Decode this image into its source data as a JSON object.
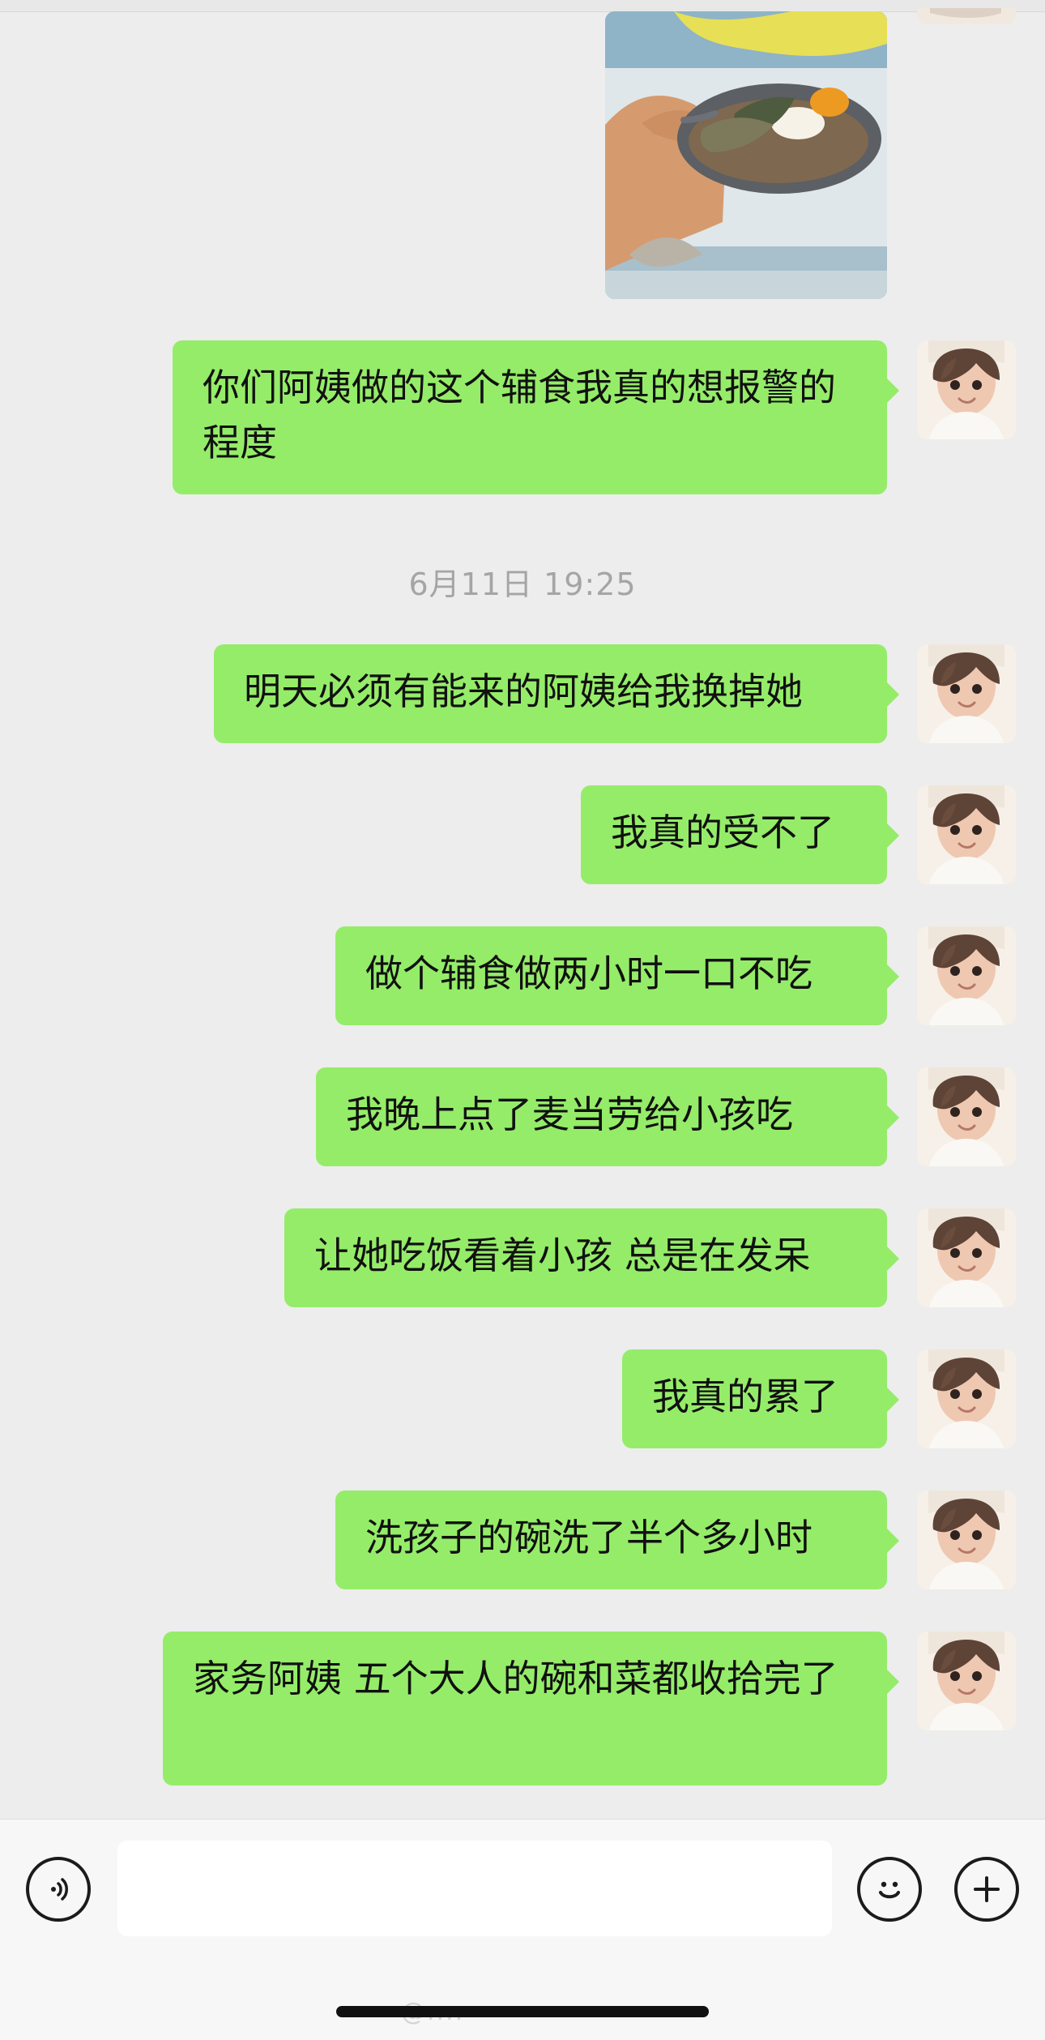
{
  "chat": {
    "timestamp": "6月11日 19:25",
    "messages": [
      {
        "text": "你们阿姨做的这个辅食我真的想报警的程度"
      },
      {
        "text": "明天必须有能来的阿姨给我换掉她"
      },
      {
        "text": "我真的受不了"
      },
      {
        "text": "做个辅食做两小时一口不吃"
      },
      {
        "text": "我晚上点了麦当劳给小孩吃"
      },
      {
        "text": "让她吃饭看着小孩 总是在发呆"
      },
      {
        "text": "我真的累了"
      },
      {
        "text": "洗孩子的碗洗了半个多小时"
      },
      {
        "text": "家务阿姨 五个大人的碗和菜都收拾完了"
      }
    ]
  },
  "input_bar": {
    "message_value": "",
    "voice_icon": "voice-icon",
    "emoji_icon": "emoji-icon",
    "plus_icon": "plus-icon"
  },
  "watermark": {
    "text": "@...."
  },
  "colors": {
    "bubble_green": "#95ec69",
    "chat_background": "#ededed",
    "input_bar_background": "#f7f7f7"
  }
}
